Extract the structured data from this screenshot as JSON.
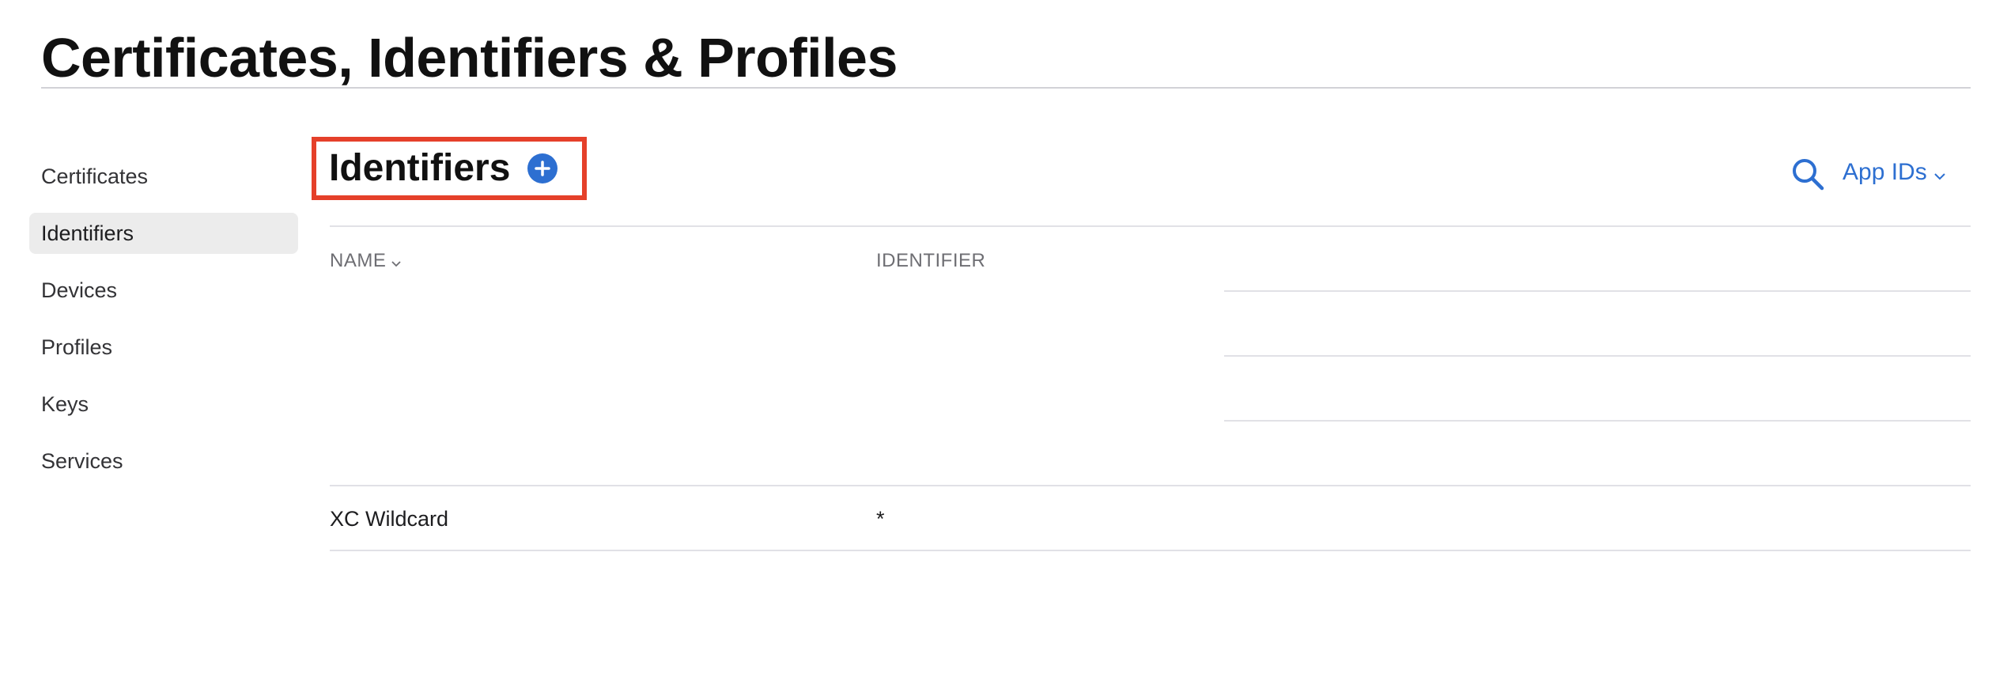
{
  "page": {
    "title": "Certificates, Identifiers & Profiles"
  },
  "sidebar": {
    "items": [
      {
        "label": "Certificates"
      },
      {
        "label": "Identifiers",
        "active": true
      },
      {
        "label": "Devices"
      },
      {
        "label": "Profiles"
      },
      {
        "label": "Keys"
      },
      {
        "label": "Services"
      }
    ]
  },
  "section": {
    "title": "Identifiers",
    "add_icon": "plus-circle-icon",
    "search_icon": "search-icon",
    "filter_label": "App IDs",
    "filter_icon": "chevron-down-icon"
  },
  "table": {
    "columns": [
      {
        "label": "NAME",
        "sortable": true
      },
      {
        "label": "IDENTIFIER"
      }
    ],
    "rows": [
      {
        "name": "XC Wildcard",
        "identifier": "*"
      }
    ]
  },
  "colors": {
    "accent": "#2d6fd1",
    "highlight_border": "#e5402a",
    "sidebar_active_bg": "#ececec",
    "divider": "#e1e1e6"
  }
}
